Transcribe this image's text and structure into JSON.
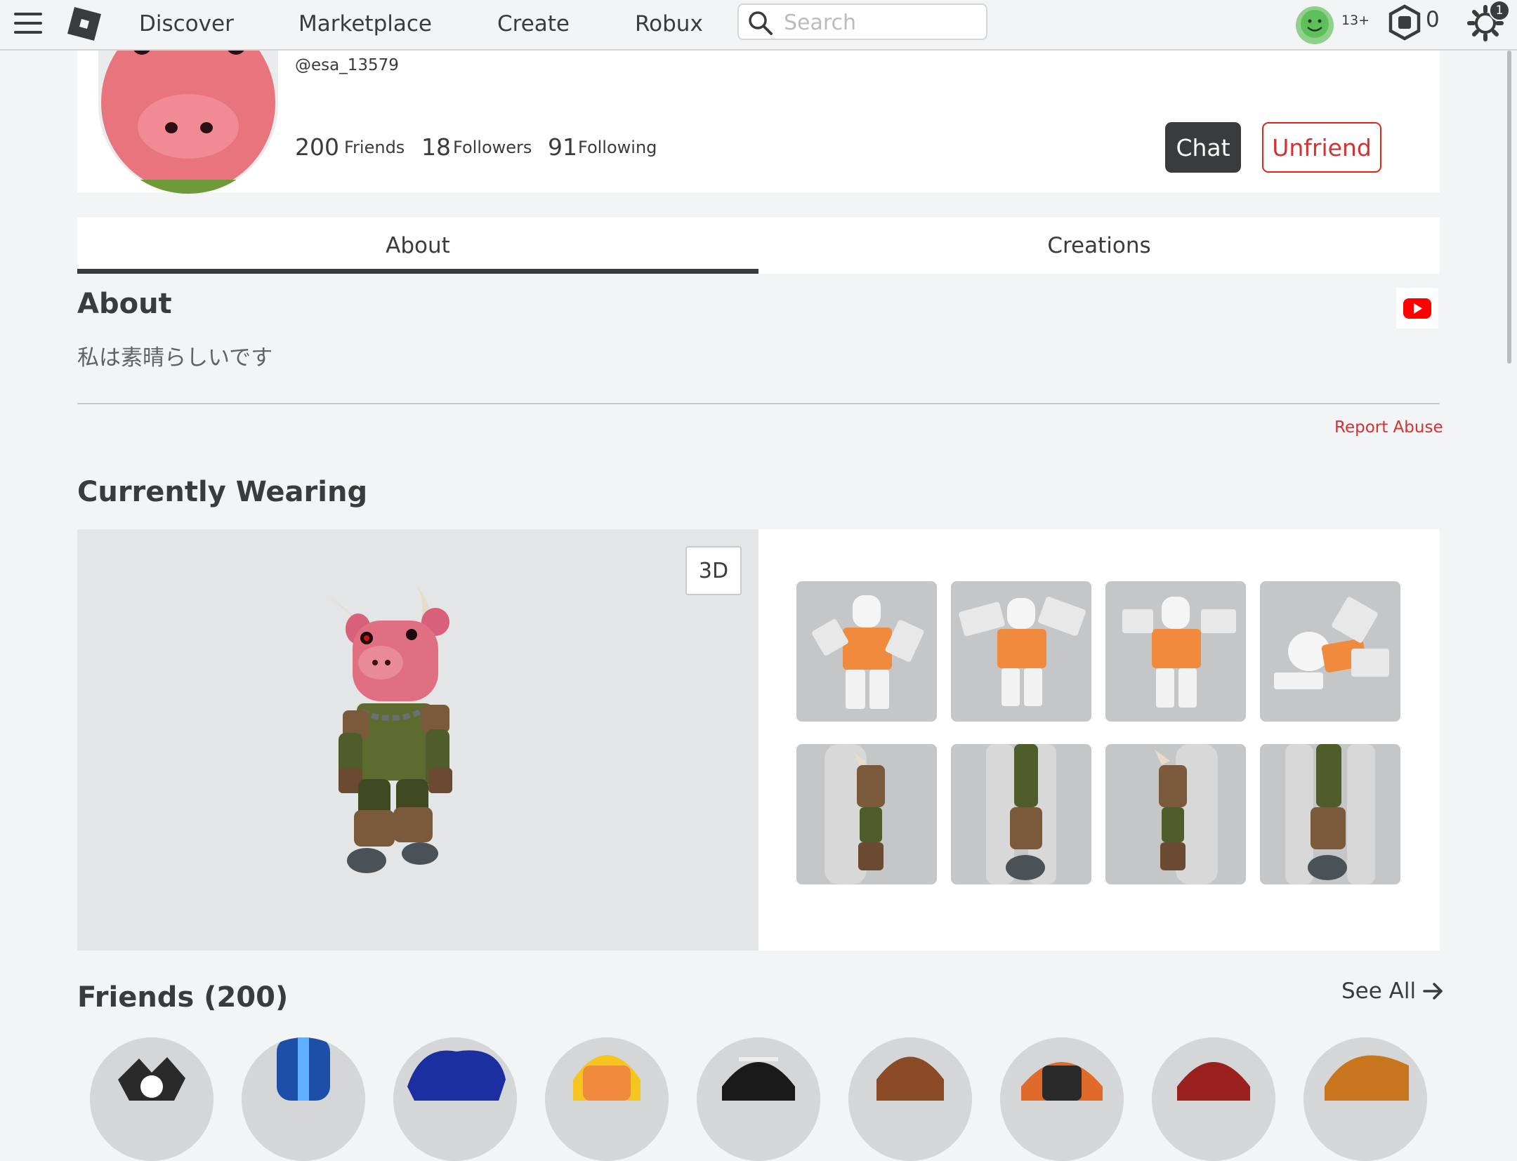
{
  "nav": {
    "links": [
      "Discover",
      "Marketplace",
      "Create",
      "Robux"
    ],
    "search_placeholder": "Search",
    "age_label": "13+",
    "robux_balance": "0",
    "notification_count": "1"
  },
  "profile": {
    "handle": "@esa_13579",
    "friends_count": "200",
    "friends_label": "Friends",
    "followers_count": "18",
    "followers_label": "Followers",
    "following_count": "91",
    "following_label": "Following",
    "chat_label": "Chat",
    "unfriend_label": "Unfriend"
  },
  "tabs": [
    "About",
    "Creations"
  ],
  "about": {
    "title": "About",
    "body": "私は素晴らしいです",
    "report_label": "Report Abuse"
  },
  "wearing": {
    "title": "Currently Wearing",
    "toggle_label": "3D"
  },
  "friends": {
    "title": "Friends (200)",
    "see_all_label": "See All"
  },
  "colors": {
    "accent_red": "#e2231a",
    "text": "#393b3d",
    "background": "#f2f4f5"
  }
}
